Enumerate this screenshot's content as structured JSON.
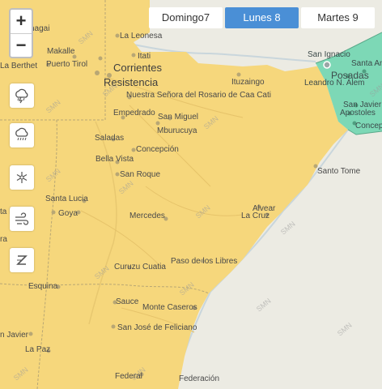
{
  "zoom": {
    "in_label": "+",
    "out_label": "−"
  },
  "tabs": [
    {
      "label": "Domingo7",
      "active": false
    },
    {
      "label": "Lunes 8",
      "active": true
    },
    {
      "label": "Martes 9",
      "active": false
    }
  ],
  "alert_colors": {
    "yellow": "#f6d77c",
    "green": "#7dd8b6",
    "land": "#ecebe3"
  },
  "side_icons": [
    "storm-rain-icon",
    "rain-icon",
    "snow-icon",
    "wind-icon",
    "zonda-icon"
  ],
  "watermark": "SMN",
  "places": {
    "chagai": "chagai",
    "la_leonesa": "La Leonesa",
    "makalle": "Makalle",
    "la_berthet": "La Berthet",
    "puerto_tirol": "Puerto Tirol",
    "itati": "Itati",
    "corrientes": "Corrientes",
    "resistencia": "Resistencia",
    "san_ignacio": "San Ignacio",
    "santa_ana": "Santa Ana",
    "posadas": "Posadas",
    "leandro_alem": "Leandro N. Alem",
    "ituzaingo": "Ituzaingo",
    "caa_cati": "Nuestra Señora del Rosario de Caa Cati",
    "san_javier_m": "San Javier",
    "apostoles": "Apostoles",
    "concepcion_m": "Concep",
    "empedrado": "Empedrado",
    "san_miguel": "San Miguel",
    "mburucuya": "Mburucuya",
    "saladas": "Saladas",
    "concepcion": "Concepción",
    "bella_vista": "Bella Vista",
    "santo_tome": "Santo Tome",
    "san_roque": "San Roque",
    "santa_lucia": "Santa Lucia",
    "goya": "Goya",
    "alvear": "Alvear",
    "la_cruz": "La Cruz",
    "mercedes": "Mercedes",
    "paso_libres": "Paso de los Libres",
    "curuzu": "Curuzu Cuatia",
    "esquina": "Esquina",
    "sauce": "Sauce",
    "monte_caseros": "Monte Caseros",
    "san_jose": "San José de Feliciano",
    "san_javier_s": "n Javier",
    "la_paz": "La Paz",
    "federal": "Federal",
    "federacion": "Federación",
    "ta_fe": "ta Fe",
    "ra": "ra"
  }
}
